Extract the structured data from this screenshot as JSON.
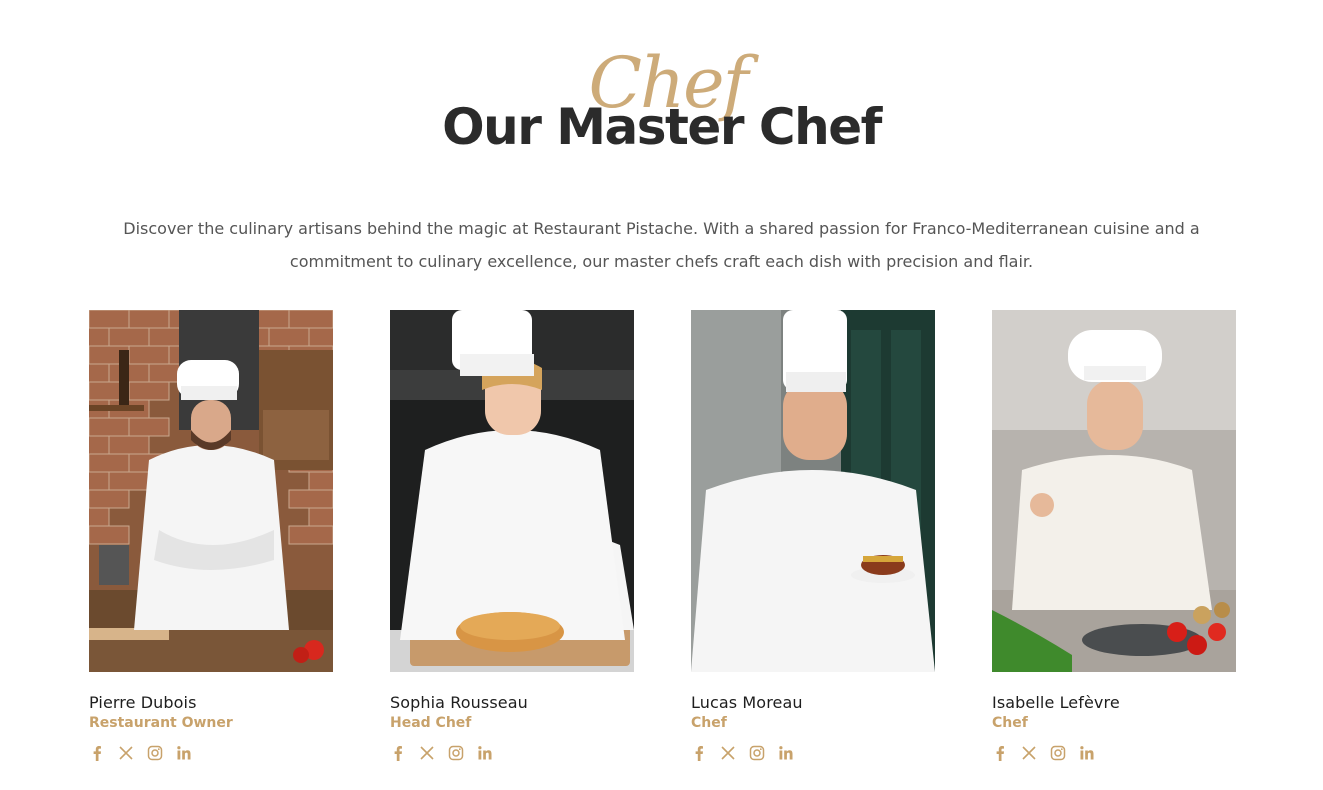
{
  "section": {
    "script_word": "Chef",
    "title": "Our Master Chef",
    "intro": "Discover the culinary artisans behind the magic at Restaurant Pistache. With a shared passion for Franco-Mediterranean cuisine and a commitment to culinary excellence, our master chefs craft each dish with precision and flair."
  },
  "accent_color": "#c8a26b",
  "chefs": [
    {
      "name": "Pierre Dubois",
      "role": "Restaurant Owner"
    },
    {
      "name": "Sophia Rousseau",
      "role": "Head Chef"
    },
    {
      "name": "Lucas Moreau",
      "role": "Chef"
    },
    {
      "name": "Isabelle Lefèvre",
      "role": "Chef"
    }
  ],
  "social_icons": [
    "facebook-icon",
    "x-twitter-icon",
    "instagram-icon",
    "linkedin-icon"
  ]
}
